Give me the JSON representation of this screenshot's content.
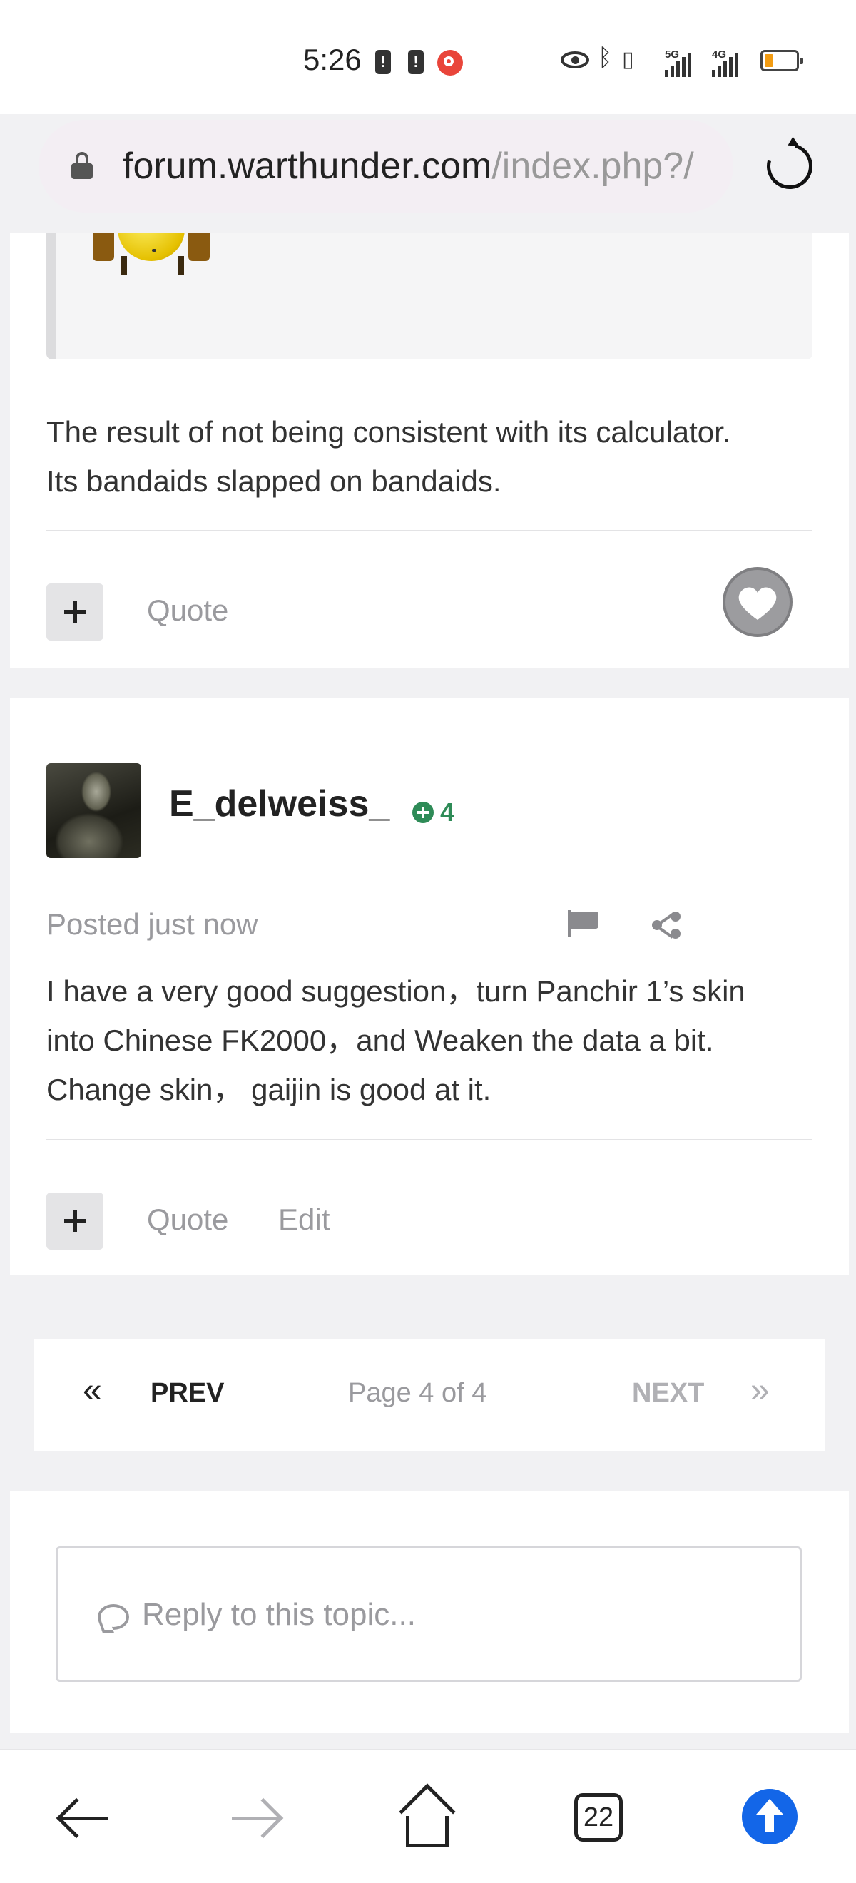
{
  "status_bar": {
    "time": "5:26",
    "signal_1_label": "5G",
    "signal_2_label": "4G"
  },
  "browser": {
    "url_domain": "forum.warthunder.com",
    "url_path": "/index.php?/"
  },
  "post_1": {
    "text_line_1": "The result of not being consistent with its calculator.",
    "text_line_2": "Its bandaids slapped on bandaids.",
    "quote_label": "Quote"
  },
  "post_2": {
    "username": "E_delweiss_",
    "reputation": "4",
    "posted": "Posted just now",
    "text_line_1": "I have a very good suggestion，turn Panchir 1’s skin",
    "text_line_2": "into Chinese FK2000，and Weaken the data a bit.",
    "text_line_3": "Change skin， gaijin is good at it.",
    "quote_label": "Quote",
    "edit_label": "Edit"
  },
  "pager": {
    "prev_label": "PREV",
    "info": "Page 4 of 4",
    "next_label": "NEXT"
  },
  "reply": {
    "placeholder": "Reply to this topic..."
  },
  "bottom_nav": {
    "tab_count": "22"
  },
  "colors": {
    "accent_blue": "#1366e8",
    "reputation_green": "#2e8b57",
    "muted_text": "#9a9a9e"
  },
  "icons": [
    "lock-icon",
    "reload-icon",
    "plus-icon",
    "heart-icon",
    "plus-circle-icon",
    "flag-icon",
    "share-icon",
    "chevron-double-left-icon",
    "chevron-double-right-icon",
    "comment-icon",
    "back-arrow-icon",
    "forward-arrow-icon",
    "home-icon",
    "tabs-icon",
    "upload-icon"
  ]
}
